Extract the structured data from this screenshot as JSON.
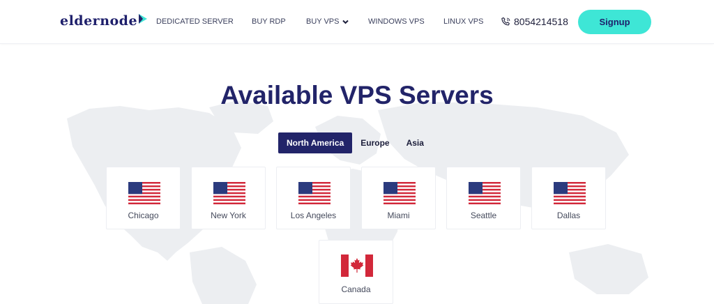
{
  "header": {
    "logo_text": "eldernode",
    "nav": [
      "DEDICATED SERVER",
      "BUY RDP",
      "BUY VPS",
      "WINDOWS VPS",
      "LINUX VPS"
    ],
    "phone": "8054214518",
    "signup_label": "Signup"
  },
  "main": {
    "title": "Available VPS Servers",
    "tabs": [
      "North America",
      "Europe",
      "Asia"
    ],
    "active_tab": "North America",
    "locations": [
      {
        "city": "Chicago",
        "flag": "us-flag-icon"
      },
      {
        "city": "New York",
        "flag": "us-flag-icon"
      },
      {
        "city": "Los Angeles",
        "flag": "us-flag-icon"
      },
      {
        "city": "Miami",
        "flag": "us-flag-icon"
      },
      {
        "city": "Seattle",
        "flag": "us-flag-icon"
      },
      {
        "city": "Dallas",
        "flag": "us-flag-icon"
      },
      {
        "city": "Canada",
        "flag": "canada-flag-icon"
      }
    ]
  },
  "colors": {
    "brand_navy": "#222469",
    "accent_teal": "#3ee6d6",
    "flag_red": "#d2283a",
    "flag_blue": "#2b3b7e"
  }
}
